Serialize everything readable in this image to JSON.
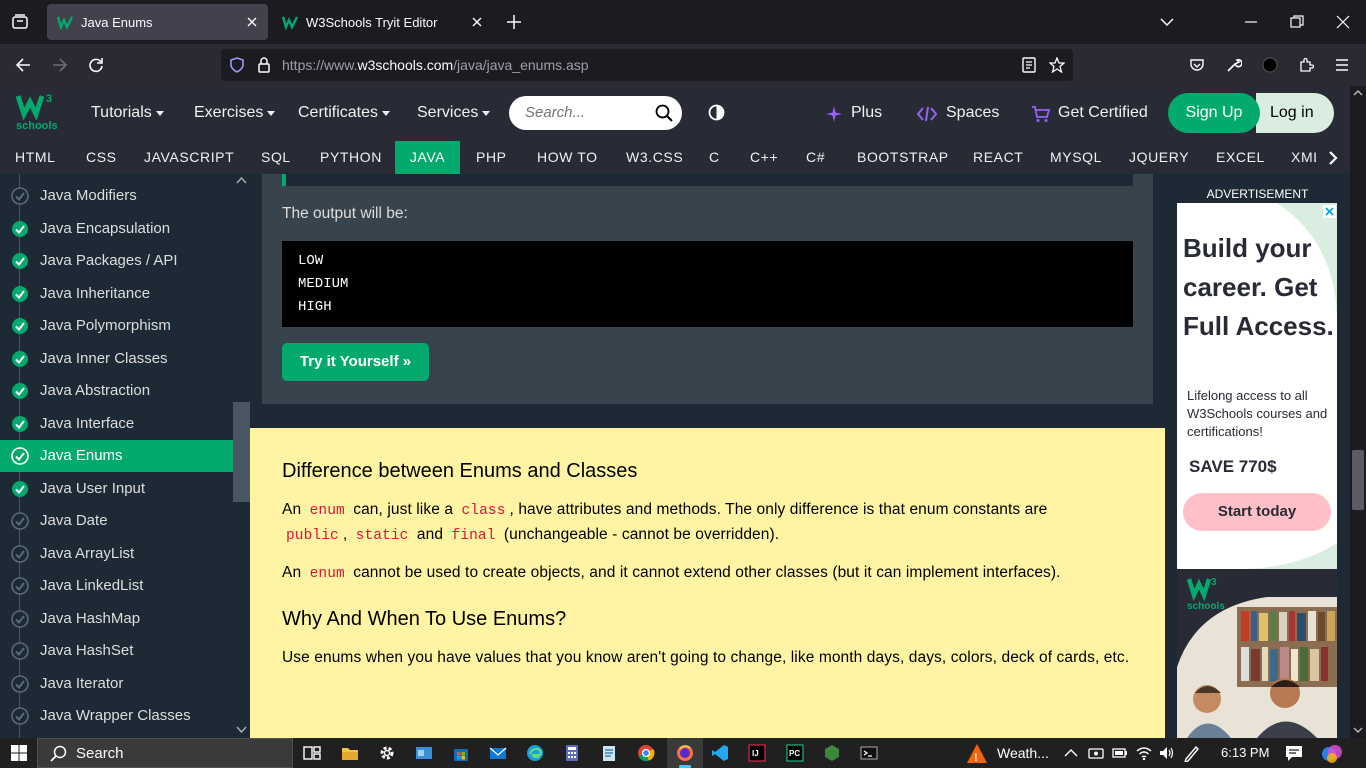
{
  "browser": {
    "tabs": [
      {
        "title": "Java Enums",
        "active": true
      },
      {
        "title": "W3Schools Tryit Editor",
        "active": false
      }
    ],
    "url_prefix": "https://www.",
    "url_domain": "w3schools.com",
    "url_path": "/java/java_enums.asp"
  },
  "header": {
    "logo_top": "W3",
    "logo_bottom": "schools",
    "menus": [
      "Tutorials",
      "Exercises",
      "Certificates",
      "Services"
    ],
    "search_placeholder": "Search...",
    "plus": "Plus",
    "spaces": "Spaces",
    "get_certified": "Get Certified",
    "sign_up": "Sign Up",
    "log_in": "Log in"
  },
  "topnav": [
    "HTML",
    "CSS",
    "JAVASCRIPT",
    "SQL",
    "PYTHON",
    "JAVA",
    "PHP",
    "HOW TO",
    "W3.CSS",
    "C",
    "C++",
    "C#",
    "BOOTSTRAP",
    "REACT",
    "MYSQL",
    "JQUERY",
    "EXCEL",
    "XML"
  ],
  "topnav_active": "JAVA",
  "sidebar": [
    {
      "label": "Java Modifiers",
      "done": false
    },
    {
      "label": "Java Encapsulation",
      "done": true
    },
    {
      "label": "Java Packages / API",
      "done": true
    },
    {
      "label": "Java Inheritance",
      "done": true
    },
    {
      "label": "Java Polymorphism",
      "done": true
    },
    {
      "label": "Java Inner Classes",
      "done": true
    },
    {
      "label": "Java Abstraction",
      "done": true
    },
    {
      "label": "Java Interface",
      "done": true
    },
    {
      "label": "Java Enums",
      "done": true,
      "active": true
    },
    {
      "label": "Java User Input",
      "done": true
    },
    {
      "label": "Java Date",
      "done": false
    },
    {
      "label": "Java ArrayList",
      "done": false
    },
    {
      "label": "Java LinkedList",
      "done": false
    },
    {
      "label": "Java HashMap",
      "done": false
    },
    {
      "label": "Java HashSet",
      "done": false
    },
    {
      "label": "Java Iterator",
      "done": false
    },
    {
      "label": "Java Wrapper Classes",
      "done": false
    }
  ],
  "example": {
    "output_label": "The output will be:",
    "output_lines": [
      "LOW",
      "MEDIUM",
      "HIGH"
    ],
    "try_button": "Try it Yourself »"
  },
  "content": {
    "h_difference": "Difference between Enums and Classes",
    "p1_a": "An",
    "p1_enum": "enum",
    "p1_b": "can, just like a",
    "p1_class": "class",
    "p1_c": ", have attributes and methods. The only difference is that enum constants are",
    "p1_public": "public",
    "p1_comma": ",",
    "p1_static": "static",
    "p1_and": "and",
    "p1_final": "final",
    "p1_d": "(unchangeable - cannot be overridden).",
    "p2_a": "An",
    "p2_enum": "enum",
    "p2_b": "cannot be used to create objects, and it cannot extend other classes (but it can implement interfaces).",
    "h_why": "Why And When To Use Enums?",
    "p3": "Use enums when you have values that you know aren't going to change, like month days, days, colors, deck of cards, etc."
  },
  "ad": {
    "label": "ADVERTISEMENT",
    "headline": "Build your career. Get Full Access.",
    "body": "Lifelong access to all W3Schools courses and certifications!",
    "save": "SAVE 770$",
    "cta": "Start today",
    "logo_top": "W3",
    "logo_bottom": "schools"
  },
  "taskbar": {
    "search": "Search",
    "weather": "Weath...",
    "time": "6:13 PM"
  },
  "colors": {
    "w3_green": "#04aa6d",
    "w3_dark": "#282a35",
    "sidebar_bg": "#1d2a35",
    "note_yellow": "#fff4a3",
    "code_red": "#dc143c"
  }
}
